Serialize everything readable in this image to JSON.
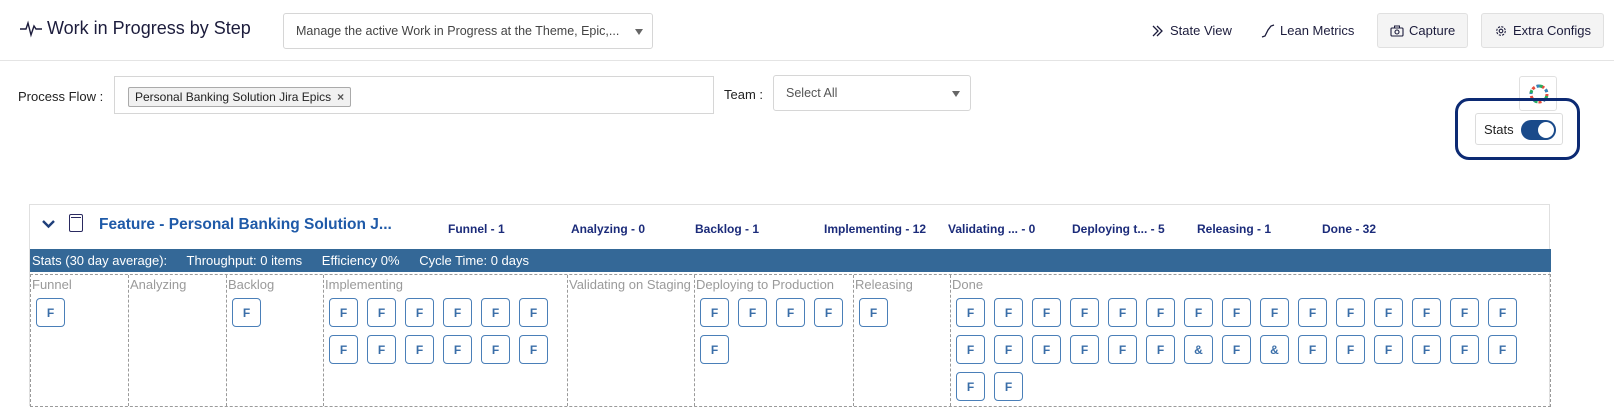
{
  "header": {
    "title": "Work in Progress by Step",
    "description": "Manage the active Work in Progress at the Theme, Epic,...",
    "buttons": {
      "state_view": "State View",
      "lean_metrics": "Lean Metrics",
      "capture": "Capture",
      "extra_configs": "Extra Configs"
    }
  },
  "filters": {
    "process_flow_label": "Process Flow :",
    "process_flow_chip": "Personal Banking Solution Jira Epics",
    "chip_remove": "×",
    "team_label": "Team :",
    "team_value": "Select All",
    "stats_label": "Stats",
    "stats_enabled": true
  },
  "panel": {
    "title": "Feature - Personal Banking Solution J...",
    "step_counts": [
      "Funnel - 1",
      "Analyzing - 0",
      "Backlog - 1",
      "Implementing - 12",
      "Validating ... - 0",
      "Deploying t... - 5",
      "Releasing - 1",
      "Done - 32"
    ],
    "stats": {
      "prefix": "Stats (30 day average):",
      "throughput": "Throughput: 0 items",
      "efficiency": "Efficiency 0%",
      "cycle_time": "Cycle Time: 0 days"
    },
    "lanes": [
      {
        "name": "Funnel",
        "cards": [
          "F"
        ]
      },
      {
        "name": "Analyzing",
        "cards": []
      },
      {
        "name": "Backlog",
        "cards": [
          "F"
        ]
      },
      {
        "name": "Implementing",
        "cards": [
          "F",
          "F",
          "F",
          "F",
          "F",
          "F",
          "F",
          "F",
          "F",
          "F",
          "F",
          "F"
        ]
      },
      {
        "name": "Validating on Staging",
        "cards": []
      },
      {
        "name": "Deploying to Production",
        "cards": [
          "F",
          "F",
          "F",
          "F",
          "F"
        ]
      },
      {
        "name": "Releasing",
        "cards": [
          "F"
        ]
      },
      {
        "name": "Done",
        "cards": [
          "F",
          "F",
          "F",
          "F",
          "F",
          "F",
          "F",
          "F",
          "F",
          "F",
          "F",
          "F",
          "F",
          "F",
          "F",
          "F",
          "F",
          "F",
          "F",
          "F",
          "F",
          "&",
          "F",
          "&",
          "F",
          "F",
          "F",
          "F",
          "F",
          "F",
          "F",
          "F"
        ]
      }
    ]
  },
  "colors": {
    "accent": "#1f5aa8",
    "stats_bar": "#346897",
    "highlight": "#0c2a73"
  }
}
